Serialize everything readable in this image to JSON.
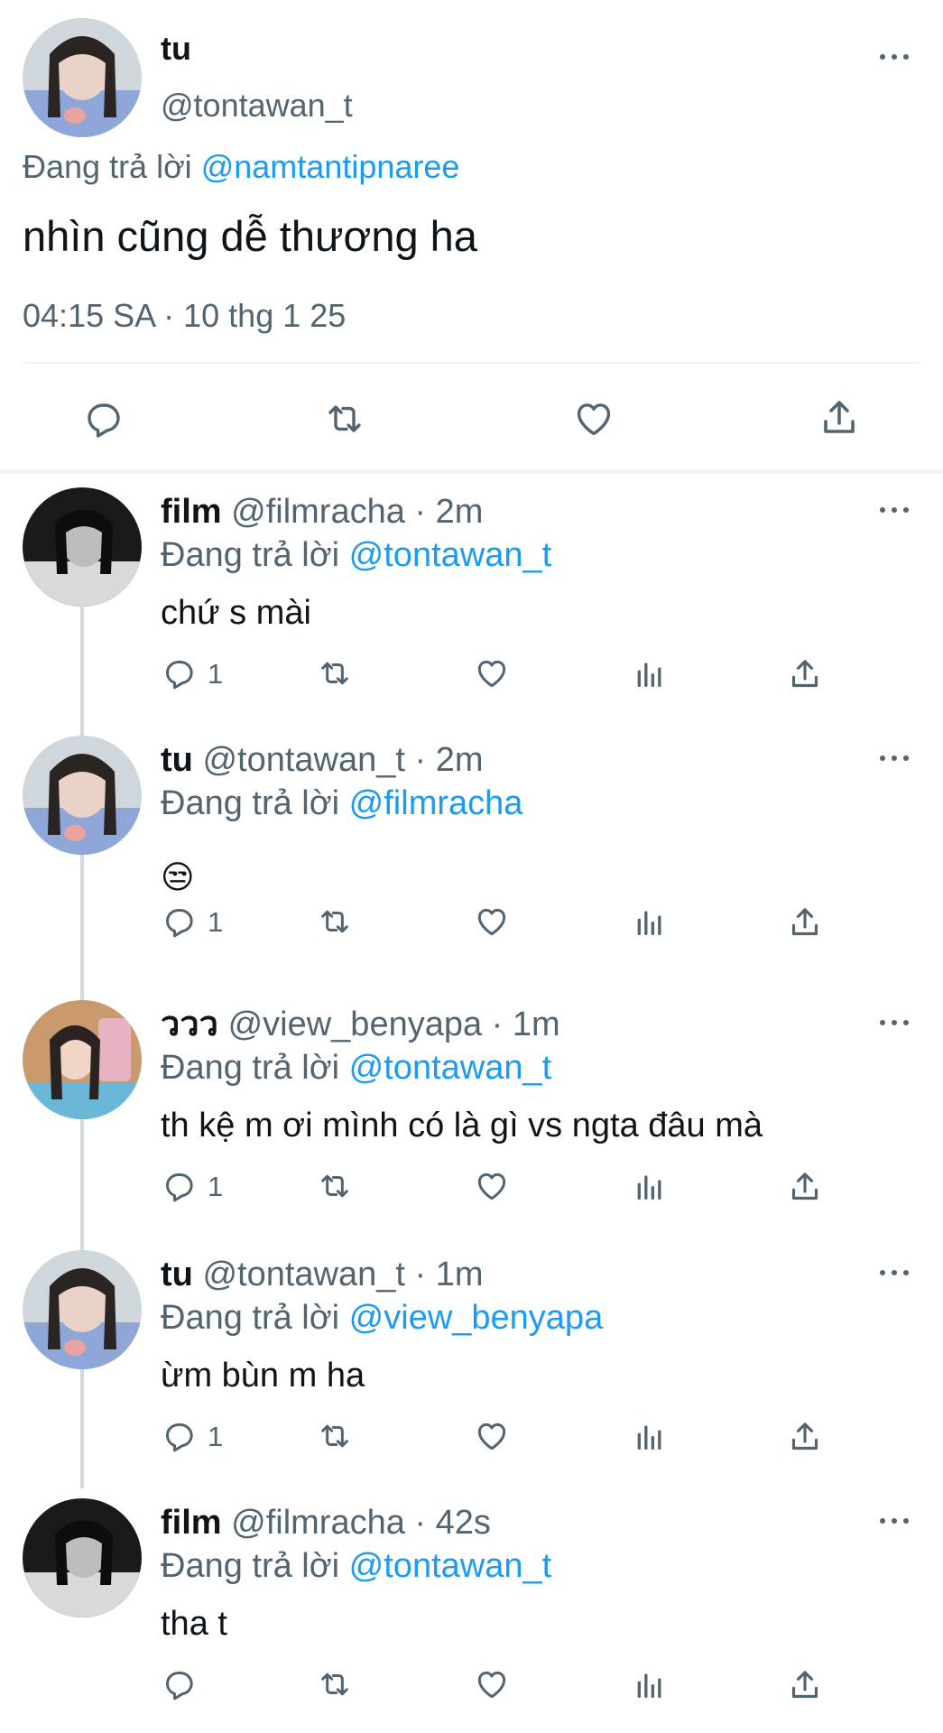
{
  "main_tweet": {
    "display_name": "tu",
    "handle": "@tontawan_t",
    "replying_prefix": "Đang trả lời",
    "replying_to": "@namtantipnaree",
    "text": "nhìn cũng dễ thương ha",
    "timestamp": "04:15 SA · 10 thg 1 25"
  },
  "replies": [
    {
      "display_name": "film",
      "handle": "@filmracha",
      "time": "· 2m",
      "replying_prefix": "Đang trả lời",
      "replying_to": "@tontawan_t",
      "text": "chứ s mài",
      "reply_count": "1",
      "avatar": "film"
    },
    {
      "display_name": "tu",
      "handle": "@tontawan_t",
      "time": "· 2m",
      "replying_prefix": "Đang trả lời",
      "replying_to": "@filmracha",
      "text": "😒",
      "reply_count": "1",
      "avatar": "tu"
    },
    {
      "display_name": "ววว",
      "handle": "@view_benyapa",
      "time": "· 1m",
      "replying_prefix": "Đang trả lời",
      "replying_to": "@tontawan_t",
      "text": "th kệ m ơi mình có là gì vs ngta đâu mà",
      "reply_count": "1",
      "avatar": "view"
    },
    {
      "display_name": "tu",
      "handle": "@tontawan_t",
      "time": "· 1m",
      "replying_prefix": "Đang trả lời",
      "replying_to": "@view_benyapa",
      "text": "ừm bùn m ha",
      "reply_count": "1",
      "avatar": "tu"
    },
    {
      "display_name": "film",
      "handle": "@filmracha",
      "time": "· 42s",
      "replying_prefix": "Đang trả lời",
      "replying_to": "@tontawan_t",
      "text": "tha t",
      "reply_count": "",
      "avatar": "film"
    }
  ],
  "colors": {
    "link": "#1d9bf0",
    "muted": "#536471",
    "divider": "#eff3f4",
    "thread_line": "#cfd9de"
  },
  "icons": [
    "reply-icon",
    "retweet-icon",
    "like-icon",
    "share-icon",
    "views-icon",
    "more-icon"
  ]
}
